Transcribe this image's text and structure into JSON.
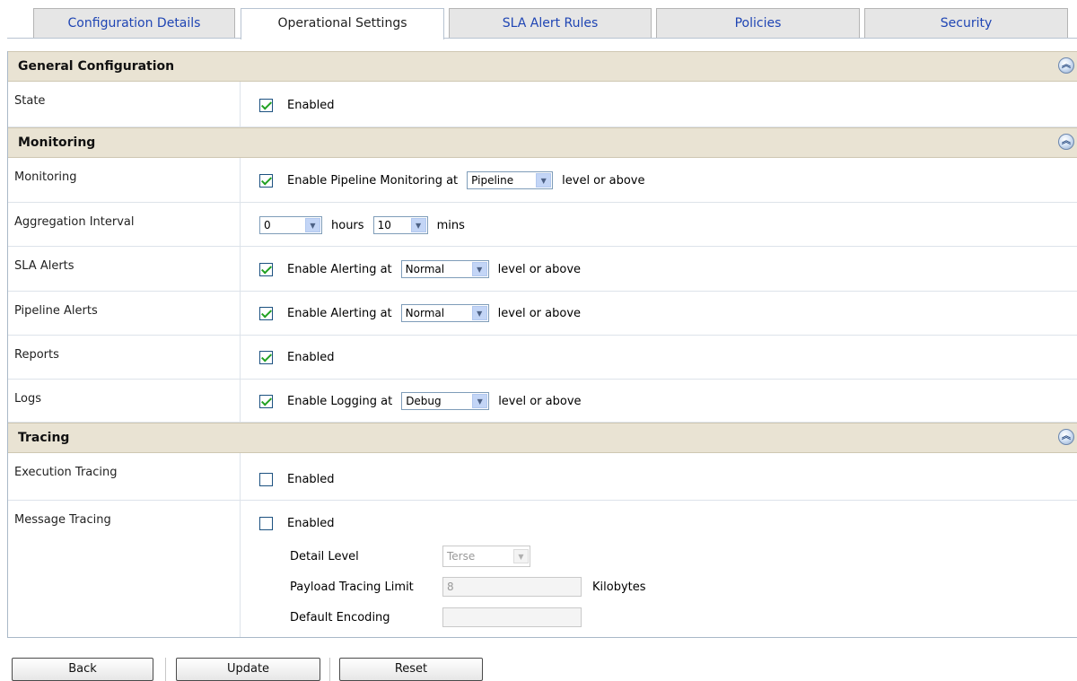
{
  "tabs": [
    {
      "label": "Configuration Details"
    },
    {
      "label": "Operational Settings"
    },
    {
      "label": "SLA Alert Rules"
    },
    {
      "label": "Policies"
    },
    {
      "label": "Security"
    }
  ],
  "active_tab": "Operational Settings",
  "sections": {
    "general": {
      "title": "General Configuration"
    },
    "monitoring": {
      "title": "Monitoring"
    },
    "tracing": {
      "title": "Tracing"
    }
  },
  "rows": {
    "state": {
      "label": "State",
      "checked": true,
      "text": "Enabled"
    },
    "monitoring": {
      "label": "Monitoring",
      "checked": true,
      "prefix": "Enable Pipeline Monitoring at",
      "select": "Pipeline",
      "suffix": "level or above"
    },
    "aggregation": {
      "label": "Aggregation Interval",
      "hours_select": "0",
      "hours_text": "hours",
      "mins_select": "10",
      "mins_text": "mins"
    },
    "sla_alerts": {
      "label": "SLA Alerts",
      "checked": true,
      "prefix": "Enable Alerting at",
      "select": "Normal",
      "suffix": "level or above"
    },
    "pipeline_alerts": {
      "label": "Pipeline Alerts",
      "checked": true,
      "prefix": "Enable Alerting at",
      "select": "Normal",
      "suffix": "level or above"
    },
    "reports": {
      "label": "Reports",
      "checked": true,
      "text": "Enabled"
    },
    "logs": {
      "label": "Logs",
      "checked": true,
      "prefix": "Enable Logging at",
      "select": "Debug",
      "suffix": "level or above"
    },
    "execution_tracing": {
      "label": "Execution Tracing",
      "checked": false,
      "text": "Enabled"
    },
    "message_tracing": {
      "label": "Message Tracing",
      "checked": false,
      "text": "Enabled",
      "detail_level_label": "Detail Level",
      "detail_level_value": "Terse",
      "payload_label": "Payload Tracing Limit",
      "payload_value": "8",
      "payload_unit": "Kilobytes",
      "encoding_label": "Default Encoding",
      "encoding_value": ""
    }
  },
  "buttons": {
    "back": "Back",
    "update": "Update",
    "reset": "Reset"
  },
  "colors": {
    "section_bg": "#e9e3d3",
    "tab_text": "#1f45b4",
    "check_green": "#21a121"
  }
}
